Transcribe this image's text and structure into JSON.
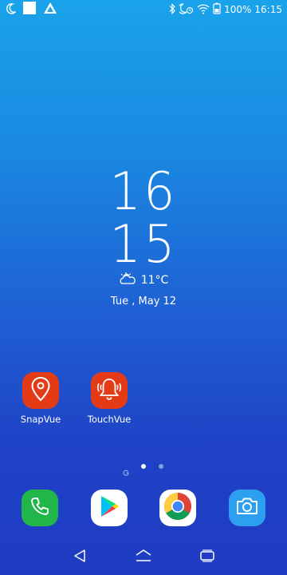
{
  "status_bar": {
    "left_icons": [
      "moon-icon",
      "square-notification-icon",
      "app-notification-icon"
    ],
    "right_icons": [
      "bluetooth-icon",
      "alarm-icon",
      "wifi-icon",
      "battery-icon"
    ],
    "battery": "100%",
    "time": "16:15"
  },
  "clock": {
    "hours": "16",
    "minutes": "15"
  },
  "weather": {
    "icon": "partly-cloudy-icon",
    "temperature": "11°C"
  },
  "date": "Tue , May 12",
  "apps": [
    {
      "label": "SnapVue",
      "icon": "location-pin-icon",
      "color": "#e43b17"
    },
    {
      "label": "TouchVue",
      "icon": "alarm-bell-icon",
      "color": "#e43b17"
    }
  ],
  "page_indicator": {
    "pages": 3,
    "current": 2,
    "first_is_google": true
  },
  "dock": [
    {
      "name": "phone",
      "icon": "phone-icon",
      "color": "#21b64a"
    },
    {
      "name": "play-store",
      "icon": "play-store-icon",
      "color": "#ffffff"
    },
    {
      "name": "chrome",
      "icon": "chrome-icon",
      "color": "#ffffff"
    },
    {
      "name": "camera",
      "icon": "camera-icon",
      "color": "#2c9ff0"
    }
  ],
  "nav_bar": [
    "back-icon",
    "home-icon",
    "recents-icon"
  ],
  "colors": {
    "background_top": "#1aa3ea",
    "background_bottom": "#1f3cc2",
    "app_red": "#e43b17"
  }
}
